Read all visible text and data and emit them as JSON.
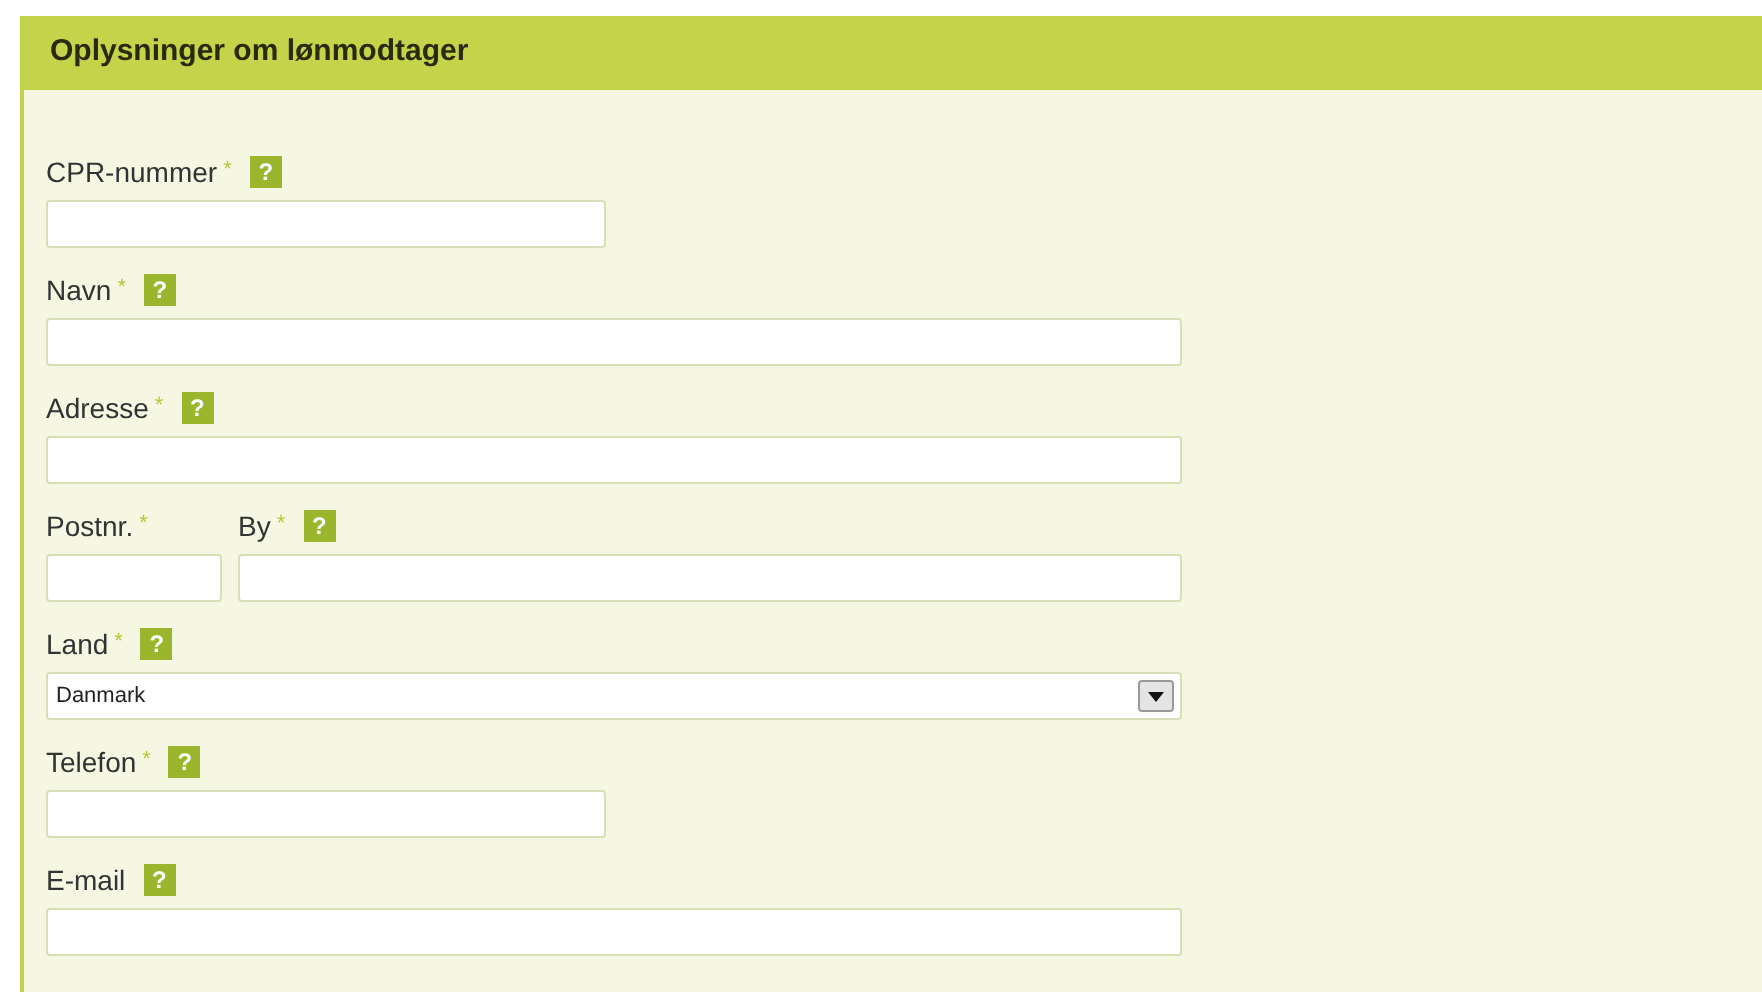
{
  "panel": {
    "title": "Oplysninger om lønmodtager"
  },
  "fields": [
    {
      "kind": "short",
      "label": "CPR-nummer",
      "required": "*",
      "help": "?"
    },
    {
      "kind": "long",
      "label": "Navn",
      "required": "*",
      "help": "?"
    },
    {
      "kind": "long",
      "label": "Adresse",
      "required": "*",
      "help": "?"
    },
    {
      "kind": "pair",
      "parts": [
        {
          "label": "Postnr.",
          "required": "*"
        },
        {
          "label": "By",
          "required": "*",
          "help": "?"
        }
      ]
    },
    {
      "kind": "select",
      "label": "Land",
      "required": "*",
      "help": "?",
      "value": "Danmark"
    },
    {
      "kind": "short",
      "label": "Telefon",
      "required": "*",
      "help": "?"
    },
    {
      "kind": "long",
      "label": "E-mail",
      "help": "?"
    }
  ]
}
